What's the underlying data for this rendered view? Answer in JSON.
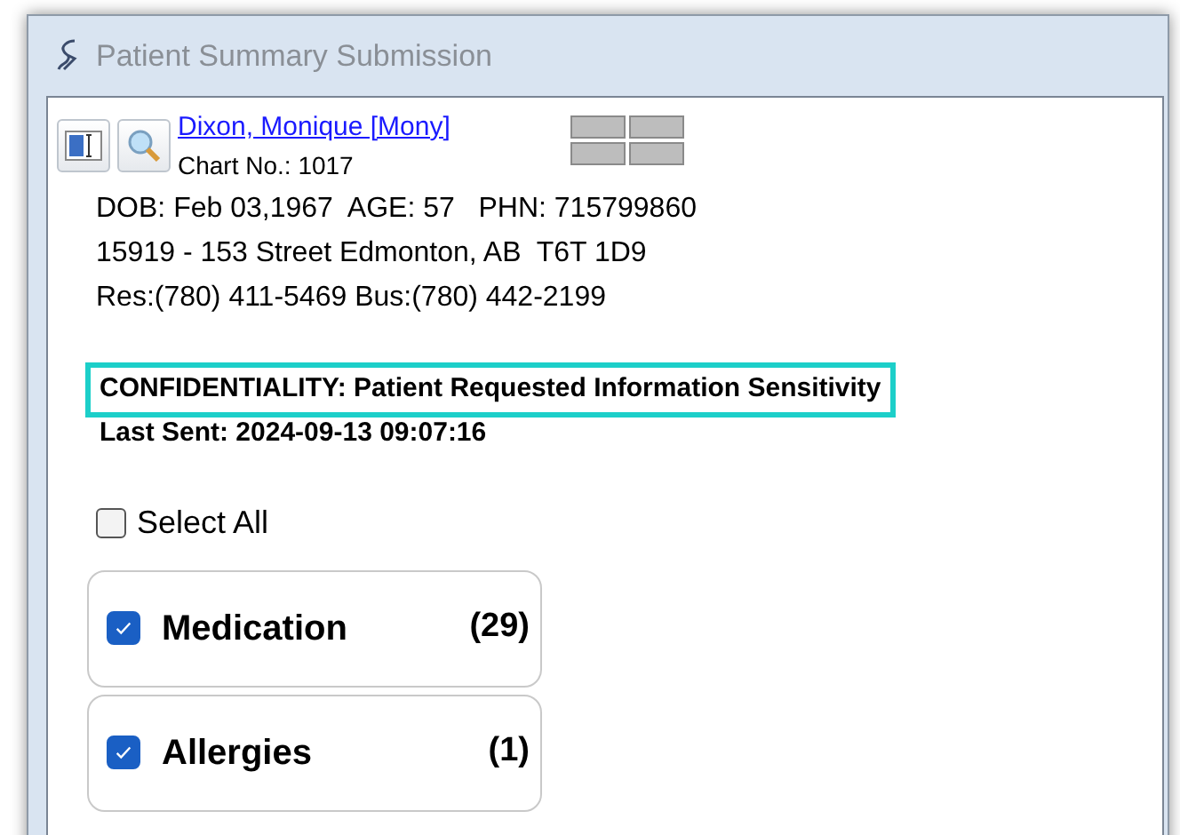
{
  "window": {
    "title": "Patient Summary Submission"
  },
  "patient": {
    "name": "Dixon, Monique [Mony]",
    "chart_no": "Chart No.: 1017",
    "dob_line": "DOB: Feb 03,1967  AGE: 57   PHN: 715799860",
    "address": "15919 - 153 Street Edmonton, AB  T6T 1D9",
    "phones": "Res:(780) 411-5469 Bus:(780) 442-2199"
  },
  "confidentiality": {
    "text": "CONFIDENTIALITY: Patient Requested Information Sensitivity",
    "highlighted": true
  },
  "last_sent": "Last Sent: 2024-09-13 09:07:16",
  "select_all": {
    "label": "Select All",
    "checked": false
  },
  "sections": [
    {
      "label": "Medication",
      "count": "(29)",
      "checked": true
    },
    {
      "label": "Allergies",
      "count": "(1)",
      "checked": true
    }
  ]
}
